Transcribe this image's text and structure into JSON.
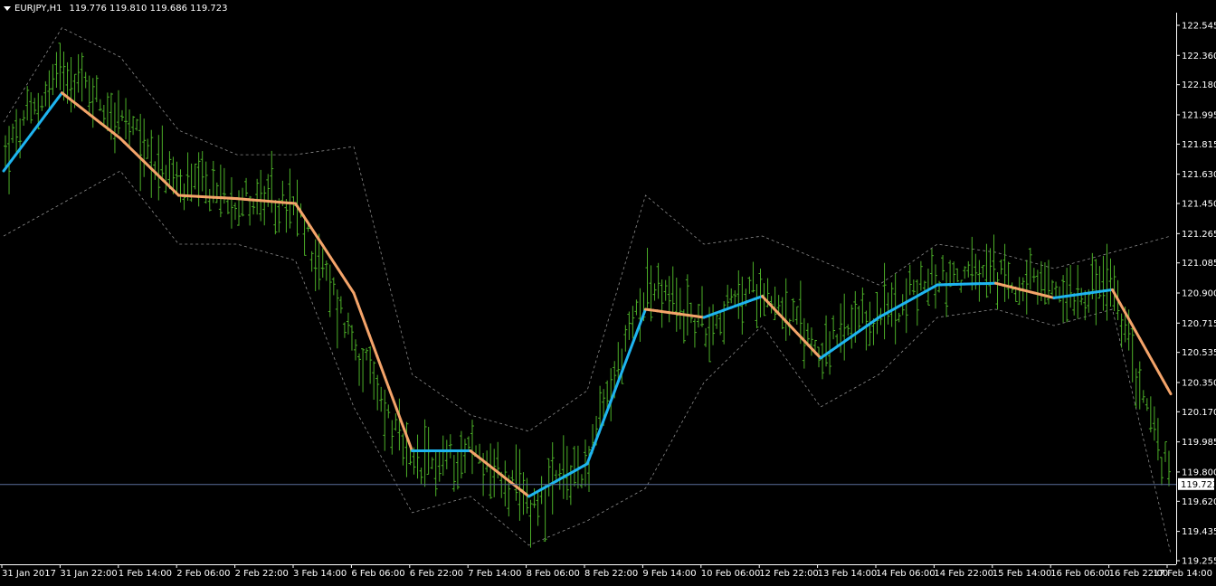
{
  "header": {
    "symbol": "EURJPY,H1",
    "ohlc": "119.776 119.810 119.686 119.723"
  },
  "colors": {
    "background": "#000000",
    "axis": "#ffffff",
    "bars": "#4caf28",
    "ma_up": "#1eb4f0",
    "ma_down": "#f4a46a",
    "bands": "#8c8c8c",
    "price_line": "#5a6d9a"
  },
  "chart_data": {
    "type": "line",
    "title": "",
    "ylim": [
      119.255,
      122.545
    ],
    "y_ticks": [
      "122.545",
      "122.360",
      "122.180",
      "121.995",
      "121.815",
      "121.630",
      "121.450",
      "121.265",
      "121.085",
      "120.900",
      "120.715",
      "120.535",
      "120.350",
      "120.170",
      "119.985",
      "119.800",
      "119.620",
      "119.435",
      "119.255"
    ],
    "x_ticks": [
      "31 Jan 2017",
      "31 Jan 22:00",
      "1 Feb 14:00",
      "2 Feb 06:00",
      "2 Feb 22:00",
      "3 Feb 14:00",
      "6 Feb 06:00",
      "6 Feb 22:00",
      "7 Feb 14:00",
      "8 Feb 06:00",
      "8 Feb 22:00",
      "9 Feb 14:00",
      "10 Feb 06:00",
      "12 Feb 22:00",
      "13 Feb 14:00",
      "14 Feb 06:00",
      "14 Feb 22:00",
      "15 Feb 14:00",
      "16 Feb 06:00",
      "16 Feb 22:00",
      "17 Feb 14:00"
    ],
    "current_price": "119.723",
    "grid": false,
    "x_points": [
      "31 Jan 2017",
      "31 Jan 22:00",
      "1 Feb 14:00",
      "2 Feb 06:00",
      "2 Feb 22:00",
      "3 Feb 14:00",
      "6 Feb 06:00",
      "6 Feb 22:00",
      "7 Feb 14:00",
      "8 Feb 06:00",
      "8 Feb 22:00",
      "9 Feb 14:00",
      "10 Feb 06:00",
      "12 Feb 22:00",
      "13 Feb 14:00",
      "14 Feb 06:00",
      "14 Feb 22:00",
      "15 Feb 14:00",
      "16 Feb 06:00",
      "16 Feb 22:00",
      "17 Feb 14:00"
    ],
    "price_points": [
      121.75,
      122.3,
      121.95,
      121.55,
      121.5,
      121.4,
      120.6,
      119.8,
      119.95,
      119.6,
      119.85,
      120.95,
      120.7,
      120.95,
      120.55,
      120.75,
      121.0,
      121.0,
      120.9,
      120.95,
      119.75
    ],
    "ma_points": [
      121.65,
      122.13,
      121.85,
      121.5,
      121.48,
      121.45,
      120.9,
      119.93,
      119.93,
      119.65,
      119.85,
      120.8,
      120.75,
      120.88,
      120.5,
      120.75,
      120.95,
      120.96,
      120.87,
      120.92,
      120.28
    ],
    "upper_band": [
      121.95,
      122.53,
      122.35,
      121.9,
      121.75,
      121.75,
      121.8,
      120.4,
      120.15,
      120.05,
      120.3,
      121.5,
      121.2,
      121.25,
      121.1,
      120.95,
      121.2,
      121.15,
      121.05,
      121.15,
      121.25
    ],
    "lower_band": [
      121.25,
      121.45,
      121.65,
      121.2,
      121.2,
      121.1,
      120.2,
      119.55,
      119.65,
      119.35,
      119.5,
      119.7,
      120.35,
      120.7,
      120.2,
      120.4,
      120.75,
      120.8,
      120.7,
      120.8,
      119.3
    ]
  }
}
